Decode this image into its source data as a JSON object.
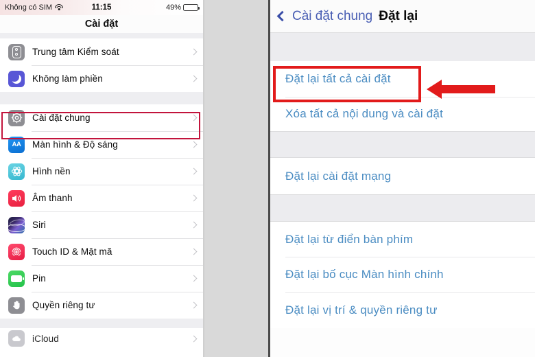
{
  "left": {
    "status_bar": {
      "carrier": "Không có SIM",
      "wifi_icon": "wifi-icon",
      "time": "11:15",
      "battery_percent": "49%",
      "battery_icon": "battery-icon",
      "battery_level": 49
    },
    "nav_title": "Cài đặt",
    "groups": [
      {
        "items": [
          {
            "label": "Trung tâm Kiểm soát",
            "icon": "control-center-icon",
            "color": "#8e8e93",
            "chevron": "chevron-right-icon"
          },
          {
            "label": "Không làm phiền",
            "icon": "moon-icon",
            "color": "#5856d6",
            "chevron": "chevron-right-icon"
          }
        ]
      },
      {
        "items": [
          {
            "label": "Cài đặt chung",
            "icon": "gear-icon",
            "color": "#8e8e93",
            "chevron": "chevron-right-icon",
            "highlighted": true
          },
          {
            "label": "Màn hình & Độ sáng",
            "icon": "display-aa-icon",
            "color": "#1f8ef1",
            "chevron": "chevron-right-icon"
          },
          {
            "label": "Hình nền",
            "icon": "wallpaper-flower-icon",
            "color": "#46c3d6",
            "chevron": "chevron-right-icon"
          },
          {
            "label": "Âm thanh",
            "icon": "speaker-icon",
            "color": "#f5274b",
            "chevron": "chevron-right-icon"
          },
          {
            "label": "Siri",
            "icon": "siri-icon",
            "color": "#3b2a6b",
            "chevron": "chevron-right-icon"
          },
          {
            "label": "Touch ID & Mật mã",
            "icon": "fingerprint-icon",
            "color": "#f02a52",
            "chevron": "chevron-right-icon"
          },
          {
            "label": "Pin",
            "icon": "battery-green-icon",
            "color": "#3ccf56",
            "chevron": "chevron-right-icon"
          },
          {
            "label": "Quyền riêng tư",
            "icon": "hand-icon",
            "color": "#8e8e93",
            "chevron": "chevron-right-icon"
          }
        ]
      },
      {
        "items": [
          {
            "label": "iCloud",
            "icon": "icloud-icon",
            "color": "#b8b8bd",
            "chevron": "chevron-right-icon"
          }
        ]
      }
    ],
    "highlight_color": "#c2143c"
  },
  "right": {
    "header": {
      "back_icon": "chevron-left-icon",
      "back_label": "Cài đặt chung",
      "title": "Đặt lại"
    },
    "groups": [
      {
        "items": [
          {
            "label": "Đặt lại tất cả cài đặt",
            "highlighted": true
          },
          {
            "label": "Xóa tất cả nội dung và cài đặt",
            "highlighted": false
          }
        ]
      },
      {
        "items": [
          {
            "label": "Đặt lại cài đặt mạng",
            "highlighted": false
          }
        ]
      },
      {
        "items": [
          {
            "label": "Đặt lại từ điển bàn phím",
            "highlighted": false
          },
          {
            "label": "Đặt lại bố cục Màn hình chính",
            "highlighted": false
          },
          {
            "label": "Đặt lại vị trí & quyền riêng tư",
            "highlighted": false
          }
        ]
      }
    ],
    "annotation": {
      "highlight_color": "#e21b1b",
      "arrow_icon": "arrow-left-icon",
      "arrow_color": "#e21b1b"
    },
    "link_color": "#4a8cc2"
  }
}
